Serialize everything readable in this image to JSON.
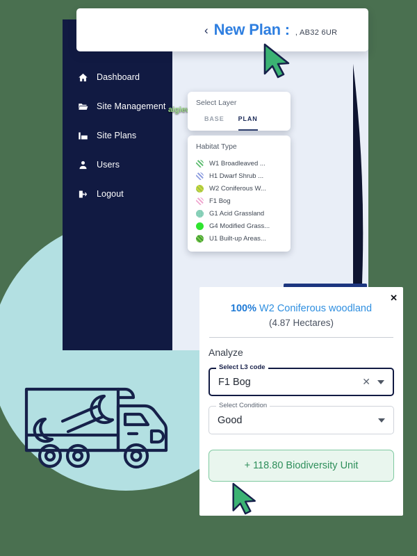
{
  "page": {
    "background_color": "#4a7050",
    "accent_blue": "#2f7fe0",
    "sidebar_color": "#111a42",
    "circle_color": "#b3e0e2",
    "green_accent": "#2f8f5b"
  },
  "header": {
    "back_icon": "chevron-left-icon",
    "title": "New Plan :",
    "postcode": ", AB32 6UR"
  },
  "sidebar": {
    "items": [
      {
        "label": "Dashboard",
        "icon": "home-icon"
      },
      {
        "label": "Site Management",
        "icon": "folder-open-icon"
      },
      {
        "label": "Site Plans",
        "icon": "site-plan-icon"
      },
      {
        "label": "Users",
        "icon": "user-icon"
      },
      {
        "label": "Logout",
        "icon": "logout-icon"
      }
    ]
  },
  "map": {
    "label": "aigiewell Wood",
    "type": "satellite-aerial"
  },
  "layer_panel": {
    "title": "Select Layer",
    "tabs": [
      {
        "label": "BASE",
        "active": false
      },
      {
        "label": "PLAN",
        "active": true
      }
    ],
    "habitat_title": "Habitat Type",
    "habitats": [
      {
        "label": "W1 Broadleaved ...",
        "color": "#5fbd72",
        "pattern": "hatch"
      },
      {
        "label": "H1 Dwarf Shrub ...",
        "color": "#8f9fe0",
        "pattern": "hatch"
      },
      {
        "label": "W2 Coniferous W...",
        "color": "#cddb3a",
        "pattern": "hatch"
      },
      {
        "label": "F1 Bog",
        "color": "#f0a8d0",
        "pattern": "hatch"
      },
      {
        "label": "G1 Acid Grassland",
        "color": "#93d6c0",
        "pattern": "dots"
      },
      {
        "label": "G4 Modified Grass...",
        "color": "#2fe52f",
        "pattern": "solid"
      },
      {
        "label": "U1 Built-up Areas...",
        "color": "#3f9b32",
        "pattern": "hatch"
      }
    ]
  },
  "analyze_panel": {
    "close_icon": "close-icon",
    "percent": "100%",
    "habitat_name": "W2 Coniferous woodland",
    "area": "(4.87 Hectares)",
    "section_title": "Analyze",
    "fields": [
      {
        "legend": "Select L3 code",
        "value": "F1 Bog",
        "has_clear": true,
        "clear_icon": "close-icon",
        "dropdown_icon": "chevron-down-icon",
        "focused": true
      },
      {
        "legend": "Select Condition",
        "value": "Good",
        "has_clear": false,
        "clear_icon": "",
        "dropdown_icon": "chevron-down-icon",
        "focused": false
      }
    ],
    "result_button": "+ 118.80 Biodiversity Unit"
  },
  "illustration": {
    "name": "truck-with-wrench-illustration",
    "stroke_color": "#16214a"
  },
  "cursors": [
    {
      "name": "cursor-pointer-header",
      "color": "#3bb273"
    },
    {
      "name": "cursor-pointer-biodiversity",
      "color": "#3bb273"
    }
  ]
}
